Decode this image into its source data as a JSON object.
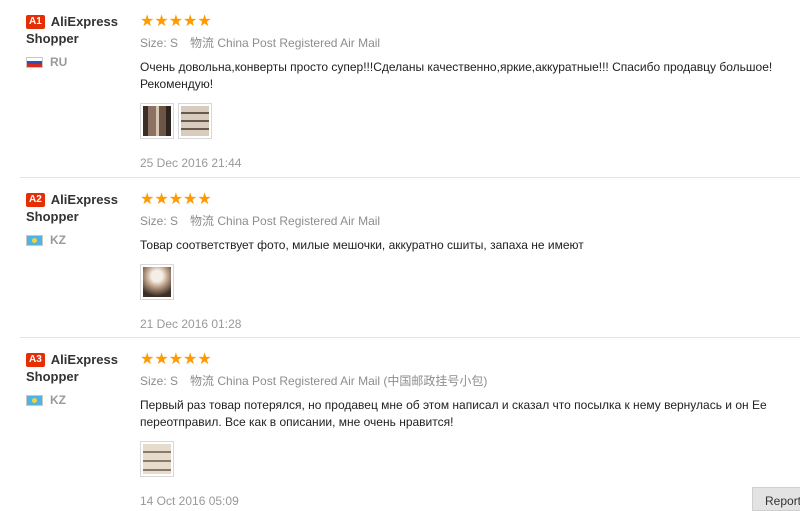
{
  "reviews": [
    {
      "badge": "A1",
      "name_first": "AliExpress",
      "name_second": "Shopper",
      "country": "RU",
      "stars": "★★★★★",
      "size_label": "Size: S",
      "logistics": "物流 China Post Registered Air Mail",
      "text": "Очень довольна,конверты просто супер!!!Сделаны качественно,яркие,аккуратные!!! Спасибо продавцу большое!Рекомендую!",
      "date": "25 Dec 2016 21:44"
    },
    {
      "badge": "A2",
      "name_first": "AliExpress",
      "name_second": "Shopper",
      "country": "KZ",
      "stars": "★★★★★",
      "size_label": "Size: S",
      "logistics": "物流 China Post Registered Air Mail",
      "text": "Товар соответствует фото, милые мешочки, аккуратно сшиты, запаха не имеют",
      "date": "21 Dec 2016 01:28"
    },
    {
      "badge": "A3",
      "name_first": "AliExpress",
      "name_second": "Shopper",
      "country": "KZ",
      "stars": "★★★★★",
      "size_label": "Size: S",
      "logistics": "物流 China Post Registered Air Mail (中国邮政挂号小包)",
      "text": "Первый раз товар потерялся, но продавец мне об этом написал и сказал что посылка к нему вернулась и он Ее переотправил. Все как в описании, мне очень нравится!",
      "date": "14 Oct 2016 05:09"
    }
  ],
  "floating_button": {
    "label": "Report"
  },
  "colors": {
    "badge": "#e62e04",
    "stars": "#ff9a00",
    "meta": "#8d8d8d"
  }
}
